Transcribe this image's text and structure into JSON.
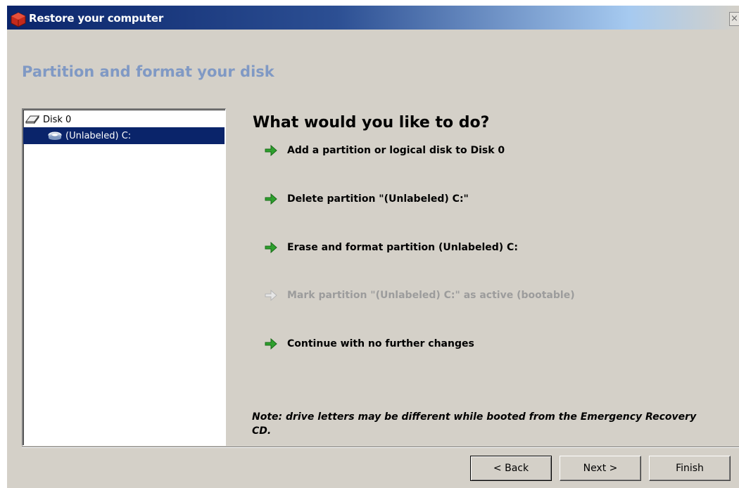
{
  "window": {
    "title": "Restore your computer",
    "close_glyph": "×"
  },
  "page": {
    "heading": "Partition and format your disk"
  },
  "tree": {
    "disk_label": "Disk 0",
    "partition_label": "(Unlabeled) C:"
  },
  "main": {
    "question": "What would you like to do?",
    "options": [
      {
        "label": "Add a partition or logical disk to Disk 0",
        "enabled": true
      },
      {
        "label": "Delete partition \"(Unlabeled) C:\"",
        "enabled": true
      },
      {
        "label": "Erase and format partition (Unlabeled) C:",
        "enabled": true
      },
      {
        "label": "Mark partition \"(Unlabeled) C:\" as active (bootable)",
        "enabled": false
      },
      {
        "label": "Continue with no further changes",
        "enabled": true
      }
    ],
    "note": "Note: drive letters may be different while booted from the Emergency Recovery CD."
  },
  "buttons": {
    "back": "< Back",
    "next": "Next >",
    "finish": "Finish"
  },
  "colors": {
    "titlebar": "#0a246a",
    "heading": "#8099c4",
    "selection": "#0a246a",
    "arrow_green": "#2ea02e",
    "disabled_text": "#9c9c9c"
  }
}
